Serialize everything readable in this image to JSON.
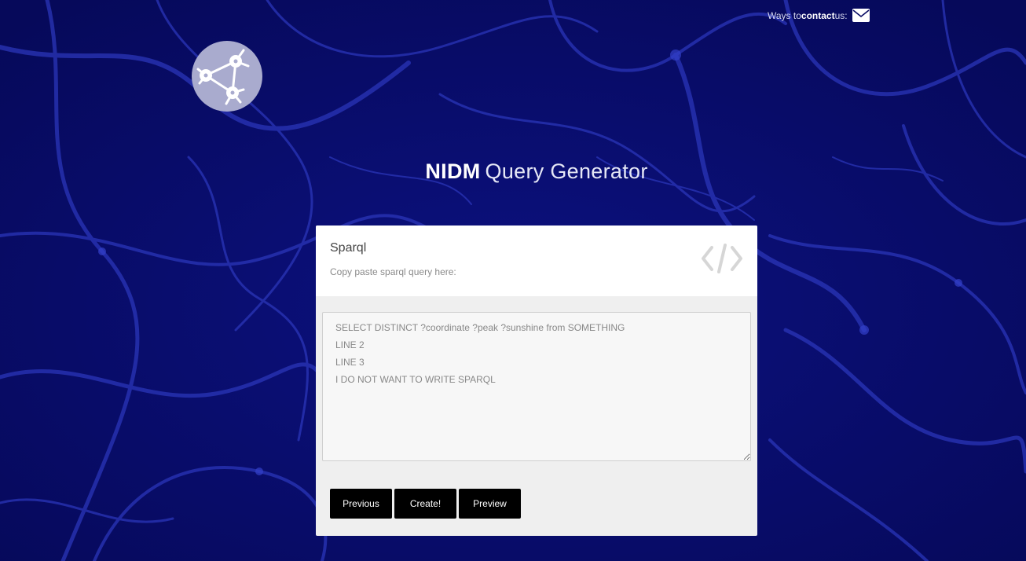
{
  "header": {
    "contact_prefix": "Ways to ",
    "contact_strong": "contact",
    "contact_suffix": " us:"
  },
  "icons": {
    "contact": "envelope-icon",
    "logo": "neuron-network-logo-icon",
    "panel": "code-brackets-icon"
  },
  "page": {
    "title_strong": "NIDM",
    "title_light": "Query Generator"
  },
  "panel": {
    "title": "Sparql",
    "subtitle": "Copy paste sparql query here:",
    "query_value": "SELECT DISTINCT ?coordinate ?peak ?sunshine from SOMETHING\nLINE 2\nLINE 3\nI DO NOT WANT TO WRITE SPARQL",
    "buttons": {
      "previous": "Previous",
      "create": "Create!",
      "preview": "Preview"
    }
  },
  "colors": {
    "background": "#070a63",
    "network_lines": "#2a35b8",
    "logo_bg": "#a9abce",
    "panel_header_bg": "#ffffff",
    "panel_body_bg": "#efefef",
    "button_bg": "#000000"
  }
}
